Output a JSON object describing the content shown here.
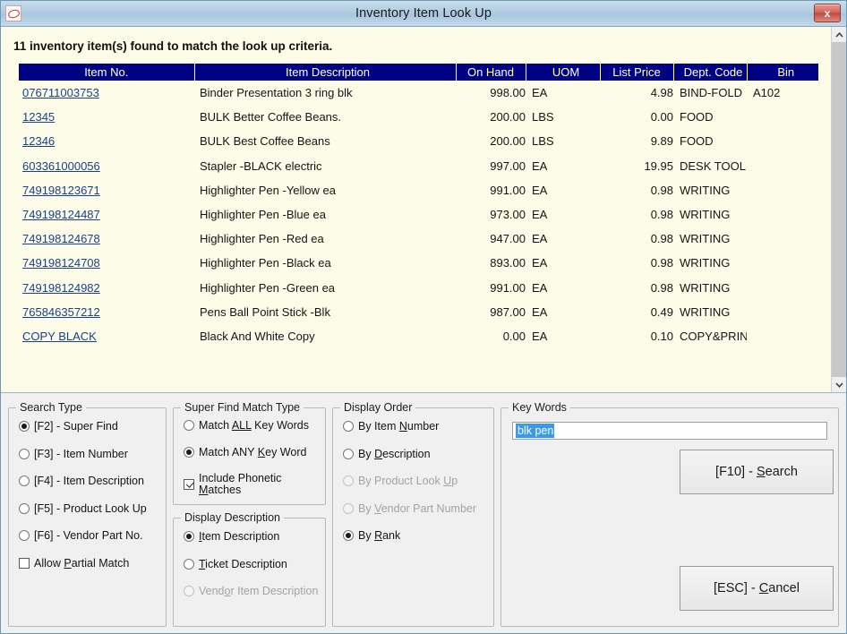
{
  "window": {
    "title": "Inventory Item Look Up",
    "app_icon": "oval-logo-icon",
    "close_label": "x"
  },
  "results": {
    "status": "11 inventory item(s) found to match the look up criteria.",
    "columns": [
      "Item No.",
      "Item Description",
      "On Hand",
      "UOM",
      "List Price",
      "Dept. Code",
      "Bin"
    ],
    "rows": [
      {
        "item_no": "076711003753",
        "description": "Binder Presentation 3 ring blk",
        "on_hand": "998.00",
        "uom": "EA",
        "list_price": "4.98",
        "dept_code": "BIND-FOLD",
        "bin": "A102"
      },
      {
        "item_no": "12345",
        "description": "BULK Better Coffee Beans.",
        "on_hand": "200.00",
        "uom": "LBS",
        "list_price": "0.00",
        "dept_code": "FOOD",
        "bin": ""
      },
      {
        "item_no": "12346",
        "description": "BULK Best Coffee Beans",
        "on_hand": "200.00",
        "uom": "LBS",
        "list_price": "9.89",
        "dept_code": "FOOD",
        "bin": ""
      },
      {
        "item_no": "603361000056",
        "description": "Stapler -BLACK electric",
        "on_hand": "997.00",
        "uom": "EA",
        "list_price": "19.95",
        "dept_code": "DESK TOOLS",
        "bin": ""
      },
      {
        "item_no": "749198123671",
        "description": "Highlighter Pen -Yellow ea",
        "on_hand": "991.00",
        "uom": "EA",
        "list_price": "0.98",
        "dept_code": "WRITING",
        "bin": ""
      },
      {
        "item_no": "749198124487",
        "description": "Highlighter Pen -Blue ea",
        "on_hand": "973.00",
        "uom": "EA",
        "list_price": "0.98",
        "dept_code": "WRITING",
        "bin": ""
      },
      {
        "item_no": "749198124678",
        "description": "Highlighter Pen -Red ea",
        "on_hand": "947.00",
        "uom": "EA",
        "list_price": "0.98",
        "dept_code": "WRITING",
        "bin": ""
      },
      {
        "item_no": "749198124708",
        "description": "Highlighter Pen -Black ea",
        "on_hand": "893.00",
        "uom": "EA",
        "list_price": "0.98",
        "dept_code": "WRITING",
        "bin": ""
      },
      {
        "item_no": "749198124982",
        "description": "Highlighter Pen -Green ea",
        "on_hand": "991.00",
        "uom": "EA",
        "list_price": "0.98",
        "dept_code": "WRITING",
        "bin": ""
      },
      {
        "item_no": "765846357212",
        "description": "Pens Ball Point Stick -Blk",
        "on_hand": "987.00",
        "uom": "EA",
        "list_price": "0.49",
        "dept_code": "WRITING",
        "bin": ""
      },
      {
        "item_no": "COPY BLACK",
        "description": "Black And White Copy",
        "on_hand": "0.00",
        "uom": "EA",
        "list_price": "0.10",
        "dept_code": "COPY&PRINT",
        "bin": ""
      }
    ]
  },
  "search_type": {
    "legend": "Search Type",
    "options": [
      {
        "label": "[F2] - Super Find",
        "selected": true
      },
      {
        "label": "[F3] - Item Number",
        "selected": false
      },
      {
        "label": "[F4] - Item Description",
        "selected": false
      },
      {
        "label": "[F5] - Product Look Up",
        "selected": false
      },
      {
        "label": "[F6] - Vendor Part No.",
        "selected": false
      }
    ],
    "allow_partial": {
      "pre": "Allow ",
      "acc": "P",
      "post": "artial Match",
      "checked": false
    }
  },
  "match_type": {
    "legend": "Super Find Match Type",
    "match_all": {
      "pre": "Match ",
      "acc": "ALL",
      "post": " Key Words",
      "selected": false
    },
    "match_any": {
      "pre": "Match ANY ",
      "acc": "K",
      "post": "ey Word",
      "selected": true
    },
    "phonetic": {
      "pre": "Include Phonetic ",
      "acc": "M",
      "post": "atches",
      "checked": true
    }
  },
  "display_description": {
    "legend": "Display Description",
    "options": [
      {
        "pre": "",
        "acc": "I",
        "post": "tem Description",
        "selected": true,
        "disabled": false
      },
      {
        "pre": "",
        "acc": "T",
        "post": "icket Description",
        "selected": false,
        "disabled": false
      },
      {
        "pre": "Vend",
        "acc": "o",
        "post": "r Item Description",
        "selected": false,
        "disabled": true
      }
    ]
  },
  "display_order": {
    "legend": "Display Order",
    "options": [
      {
        "pre": "By Item ",
        "acc": "N",
        "post": "umber",
        "selected": false,
        "disabled": false
      },
      {
        "pre": "By ",
        "acc": "D",
        "post": "escription",
        "selected": false,
        "disabled": false
      },
      {
        "pre": "By Product Look ",
        "acc": "U",
        "post": "p",
        "selected": false,
        "disabled": true
      },
      {
        "pre": "By ",
        "acc": "V",
        "post": "endor Part Number",
        "selected": false,
        "disabled": true
      },
      {
        "pre": "By ",
        "acc": "R",
        "post": "ank",
        "selected": true,
        "disabled": false
      }
    ]
  },
  "key_words": {
    "legend": "Key Words",
    "value": "blk pen",
    "placeholder": "",
    "search_button": {
      "pre": "[F10] - ",
      "acc": "S",
      "post": "earch"
    },
    "cancel_button": {
      "pre": "[ESC] - ",
      "acc": "C",
      "post": "ancel"
    }
  },
  "scrollbar": {
    "up_icon": "chevron-up-icon",
    "down_icon": "chevron-down-icon"
  }
}
